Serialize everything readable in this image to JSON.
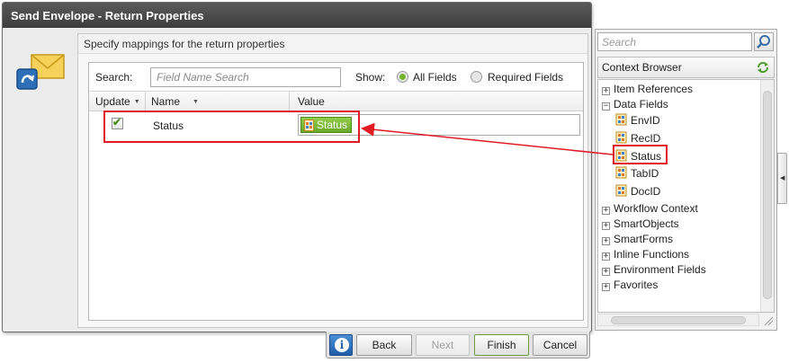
{
  "dialog": {
    "title": "Send Envelope - Return Properties",
    "panel_header": "Specify mappings for the return properties",
    "search_label": "Search:",
    "search_placeholder": "Field Name Search",
    "show_label": "Show:",
    "show_options": [
      {
        "label": "All Fields",
        "selected": true
      },
      {
        "label": "Required Fields",
        "selected": false
      }
    ],
    "columns": {
      "update": "Update",
      "name": "Name",
      "value": "Value"
    },
    "rows": [
      {
        "checked": true,
        "name": "Status",
        "value_token": "Status"
      }
    ]
  },
  "buttons": {
    "info": "i",
    "back": "Back",
    "next": "Next",
    "finish": "Finish",
    "cancel": "Cancel"
  },
  "context_browser": {
    "search_placeholder": "Search",
    "title": "Context Browser",
    "tree": [
      {
        "label": "Item References",
        "type": "folder",
        "expanded": false
      },
      {
        "label": "Data Fields",
        "type": "folder",
        "expanded": true
      },
      {
        "label": "EnvID",
        "type": "field"
      },
      {
        "label": "RecID",
        "type": "field"
      },
      {
        "label": "Status",
        "type": "field",
        "highlighted": true
      },
      {
        "label": "TabID",
        "type": "field"
      },
      {
        "label": "DocID",
        "type": "field"
      },
      {
        "label": "Workflow Context",
        "type": "folder",
        "expanded": false
      },
      {
        "label": "SmartObjects",
        "type": "folder",
        "expanded": false
      },
      {
        "label": "SmartForms",
        "type": "folder",
        "expanded": false
      },
      {
        "label": "Inline Functions",
        "type": "folder",
        "expanded": false
      },
      {
        "label": "Environment Fields",
        "type": "folder",
        "expanded": false
      },
      {
        "label": "Favorites",
        "type": "folder",
        "expanded": false
      }
    ]
  },
  "colors": {
    "accent_green": "#74b52a",
    "highlight_red": "#e01b24",
    "titlebar": "#4a4a4a"
  },
  "icons": [
    "envelope-send-icon",
    "checkbox-check-icon",
    "field-document-icon",
    "search-icon",
    "refresh-icon",
    "info-icon",
    "sort-arrow-icon"
  ]
}
